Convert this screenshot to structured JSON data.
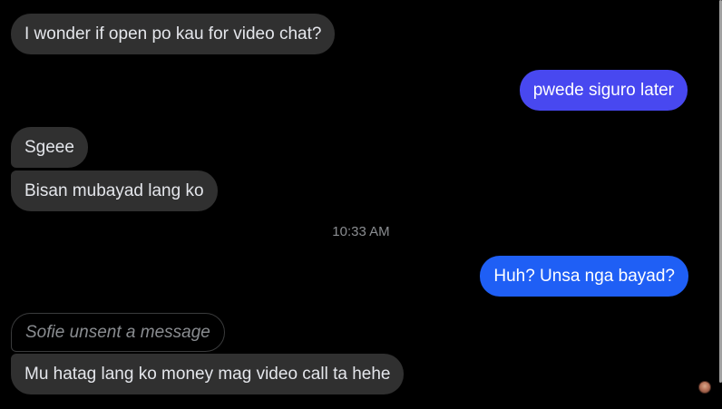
{
  "messages": [
    {
      "text": "I wonder if open po kau for video chat?"
    },
    {
      "text": "pwede siguro later"
    },
    {
      "text": "Sgeee"
    },
    {
      "text": "Bisan mubayad lang ko"
    },
    {
      "text": "Huh? Unsa nga bayad?"
    },
    {
      "text": "Mu hatag lang ko money mag video call ta hehe"
    }
  ],
  "timestamp": "10:33 AM",
  "unsent_notice": "Sofie unsent a message",
  "colors": {
    "incoming_bubble": "#303030",
    "outgoing_bubble_1": "#4848f0",
    "outgoing_bubble_2": "#1f5ff5",
    "background": "#000000",
    "secondary_text": "#8a8d91"
  },
  "icons": {
    "seen_avatar": "avatar-icon"
  }
}
